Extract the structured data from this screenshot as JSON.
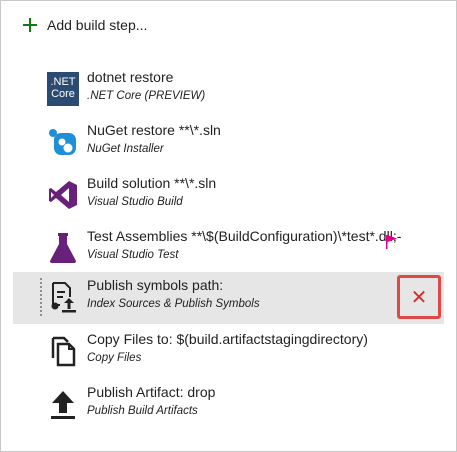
{
  "toolbar": {
    "add_step_label": "Add build step..."
  },
  "tasks": [
    {
      "title": "dotnet restore",
      "subtitle": ".NET Core (PREVIEW)",
      "icon": "dotnet-core-icon",
      "icon_text_1": ".NET",
      "icon_text_2": "Core"
    },
    {
      "title": "NuGet restore **\\*.sln",
      "subtitle": "NuGet Installer",
      "icon": "nuget-icon"
    },
    {
      "title": "Build solution **\\*.sln",
      "subtitle": "Visual Studio Build",
      "icon": "visual-studio-icon"
    },
    {
      "title": "Test Assemblies **\\$(BuildConfiguration)\\*test*.dll;-",
      "subtitle": "Visual Studio Test",
      "icon": "flask-icon"
    },
    {
      "title": "Publish symbols path:",
      "subtitle": "Index Sources & Publish Symbols",
      "icon": "publish-symbols-icon",
      "selected": true
    },
    {
      "title": "Copy Files to: $(build.artifactstagingdirectory)",
      "subtitle": "Copy Files",
      "icon": "copy-files-icon"
    },
    {
      "title": "Publish Artifact: drop",
      "subtitle": "Publish Build Artifacts",
      "icon": "upload-icon"
    }
  ],
  "delete_button": {
    "glyph": "✕"
  },
  "colors": {
    "add_plus": "#107c10",
    "selected_row": "#e6e6e6",
    "highlight_border": "#e04848",
    "delete_x": "#d0312d",
    "dotnet_bg": "#2c4b73",
    "nuget_blue": "#1f8fd6",
    "vs_purple": "#68217a",
    "flag_pink": "#e3008c"
  }
}
